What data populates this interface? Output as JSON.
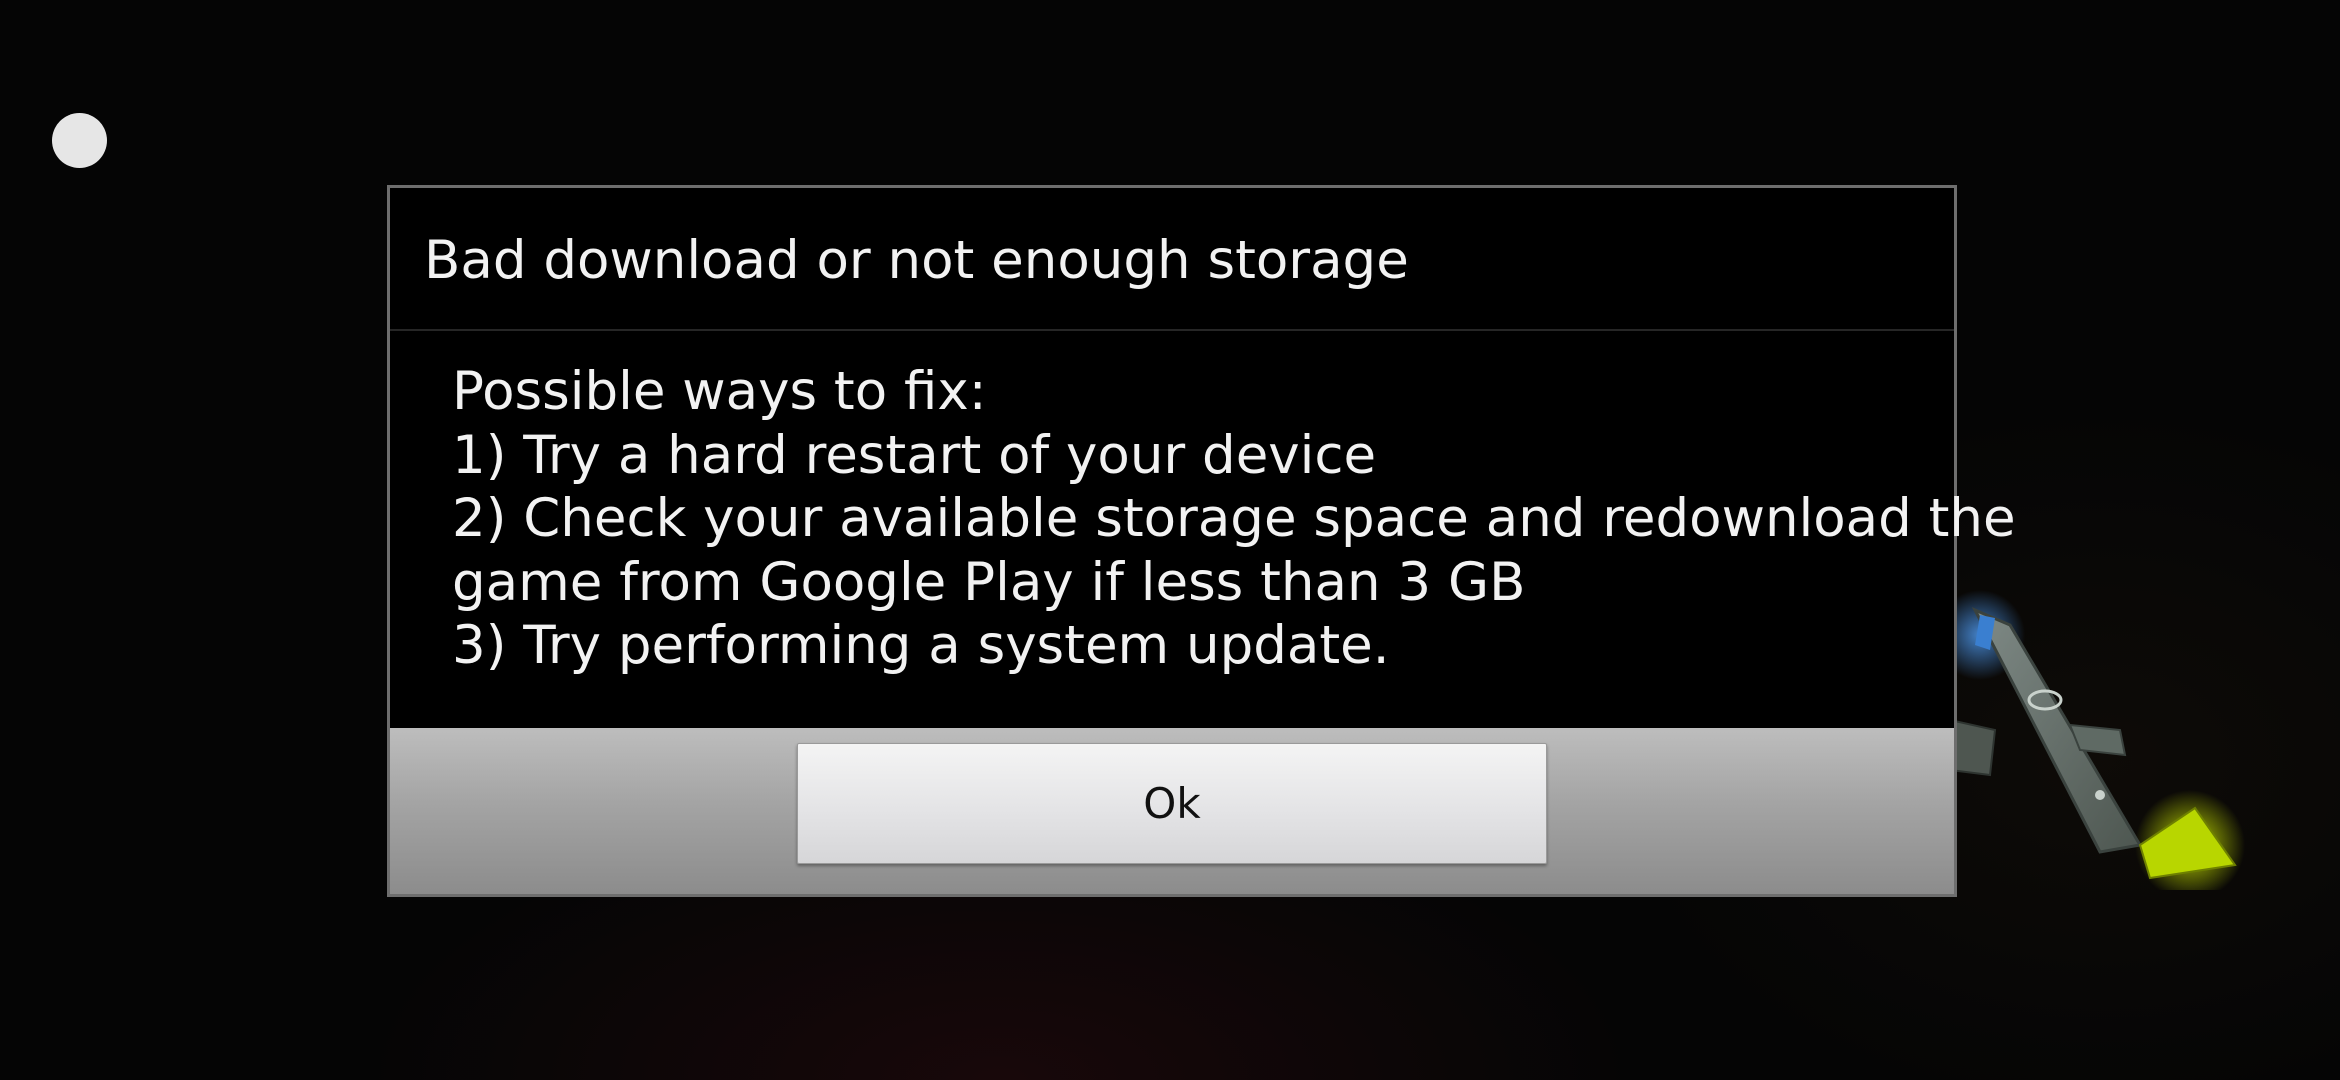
{
  "screen": {
    "background_color": "#050505"
  },
  "overlay": {
    "floating_dot_color": "#e6e6e6"
  },
  "dialog": {
    "title": "Bad download or not enough storage",
    "message_lines": [
      "Possible ways to fix:",
      "1) Try a hard restart of your device",
      "2) Check your available storage space and redownload the",
      "game from Google Play if less than 3 GB",
      "3) Try performing a system update."
    ],
    "ok_button_label": "Ok",
    "border_color": "#6e6e6e",
    "background_color": "#000000",
    "text_color": "#f2f2f2"
  },
  "background_art": {
    "logo_icon": "game-logo-icon",
    "accent_colors": [
      "#3a7fd0",
      "#c8e000",
      "#8a8a6a"
    ]
  }
}
